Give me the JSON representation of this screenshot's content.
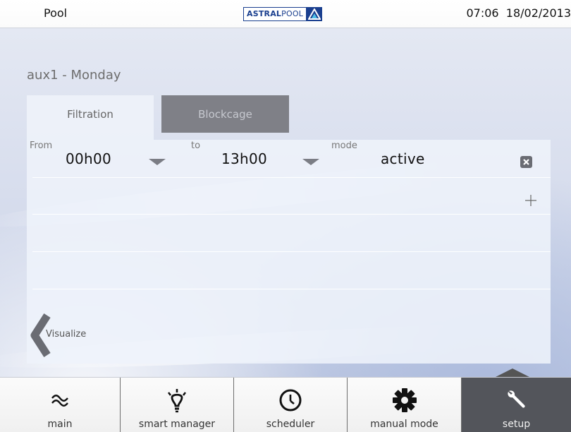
{
  "header": {
    "title": "Pool",
    "logo": "ASTRALPOOL",
    "logo_bold": "ASTRAL",
    "logo_regular": "POOL",
    "time": "07:06",
    "date": "18/02/2013"
  },
  "page": {
    "title": "aux1 - Monday"
  },
  "tabs": [
    {
      "label": "Filtration",
      "active": true
    },
    {
      "label": "Blockcage",
      "active": false
    }
  ],
  "schedule": {
    "from_label": "From",
    "to_label": "to",
    "mode_label": "mode",
    "entries": [
      {
        "from": "00h00",
        "to": "13h00",
        "mode": "active"
      }
    ]
  },
  "actions": {
    "back_label": "Visualize"
  },
  "nav": {
    "items": [
      {
        "label": "main",
        "icon": "waves-icon"
      },
      {
        "label": "smart manager",
        "icon": "lightbulb-icon"
      },
      {
        "label": "scheduler",
        "icon": "clock-icon"
      },
      {
        "label": "manual mode",
        "icon": "gear-icon"
      },
      {
        "label": "setup",
        "icon": "wrench-icon",
        "active": true
      }
    ]
  },
  "colors": {
    "brand_blue": "#1a3f8f",
    "active_nav": "#53555b",
    "inactive_tab": "#7f8087"
  }
}
